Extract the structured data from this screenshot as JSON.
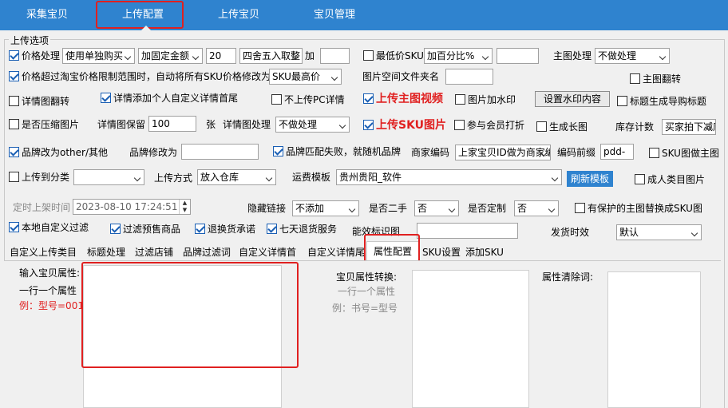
{
  "main_tabs": [
    "采集宝贝",
    "上传配置",
    "上传宝贝",
    "宝贝管理"
  ],
  "section_title": "上传选项",
  "row1": {
    "price_label": "价格处理",
    "price_mode": "使用单独购买",
    "fixed_add": "加固定金额",
    "amount": "20",
    "rounding": "四舍五入取整",
    "add_label": "加",
    "add_value": "",
    "min_price_label": "最低价SKU",
    "min_price_mode": "加百分比%",
    "min_price_value": "",
    "main_img_label": "主图处理",
    "main_img_mode": "不做处理"
  },
  "row2": {
    "exceed_label": "价格超过淘宝价格限制范围时，自动将所有SKU价格修改为",
    "exceed_value": "SKU最高价",
    "img_folder_label": "图片空间文件夹名",
    "img_folder_value": "",
    "main_flip": "主图翻转"
  },
  "row3": {
    "detail_flip": "详情图翻转",
    "detail_add": "详情添加个人自定义详情首尾",
    "no_pc": "不上传PC详情",
    "upload_video": "上传主图视频",
    "watermark": "图片加水印",
    "set_watermark": "设置水印内容",
    "title_guide": "标题生成导购标题"
  },
  "row4": {
    "compress": "是否压缩图片",
    "keep_label": "详情图保留",
    "keep_value": "100",
    "keep_unit": "张",
    "detail_proc_label": "详情图处理",
    "detail_proc_value": "不做处理",
    "upload_sku": "上传SKU图片",
    "member": "参与会员打折",
    "long_img": "生成长图",
    "stock_label": "库存计数",
    "stock_value": "买家拍下减库存"
  },
  "row5": {
    "brand_other": "品牌改为other/其他",
    "brand_modify_label": "品牌修改为",
    "brand_modify_value": "",
    "brand_fail": "品牌匹配失败，就随机品牌",
    "merchant_label": "商家编码",
    "merchant_value": "上家宝贝ID做为商家编码",
    "prefix_label": "编码前缀",
    "prefix_value": "pdd-",
    "sku_main": "SKU图做主图"
  },
  "row6": {
    "to_category": "上传到分类",
    "category_value": "",
    "method_label": "上传方式",
    "method_value": "放入仓库",
    "shipping_label": "运费模板",
    "shipping_value": "贵州贵阳_软件",
    "refresh": "刷新模板",
    "adult": "成人类目图片"
  },
  "row7": {
    "schedule_label": "定时上架时间",
    "schedule_value": "2023-08-10  17:24:51",
    "hide_label": "隐藏链接",
    "hide_value": "不添加",
    "second_label": "是否二手",
    "second_value": "否",
    "custom_label": "是否定制",
    "custom_value": "否",
    "protect": "有保护的主图替换成SKU图"
  },
  "row8": {
    "local_filter": "本地自定义过滤",
    "presale": "过滤预售商品",
    "refund": "退换货承诺",
    "seven": "七天退货服务",
    "effect_label": "能效标识图",
    "effect_value": "",
    "ship_label": "发货时效",
    "ship_value": "默认"
  },
  "sub_tabs": [
    "自定义上传类目",
    "标题处理",
    "过滤店铺",
    "品牌过滤词",
    "自定义详情首",
    "自定义详情尾",
    "属性配置",
    "SKU设置",
    "添加SKU"
  ],
  "attr": {
    "input_label": "输入宝贝属性:",
    "hint1": "一行一个属性",
    "example": "例：型号=001",
    "convert_label": "宝贝属性转换:",
    "hint2": "一行一个属性",
    "example2": "例：书号=型号",
    "clear_label": "属性清除词:"
  },
  "colors": {
    "accent": "#2f83cf",
    "highlight": "#e02020"
  }
}
